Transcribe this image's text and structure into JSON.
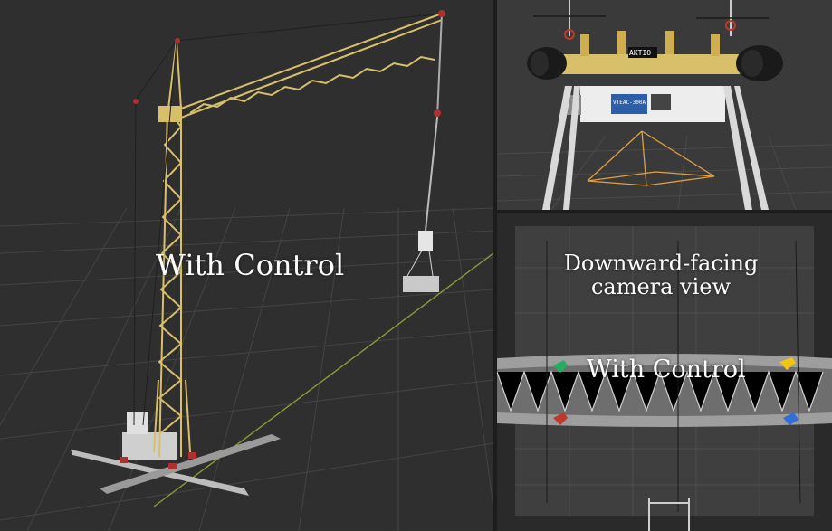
{
  "left_panel": {
    "overlay_label": "With Control",
    "scene": "crane-3d-view"
  },
  "top_right_panel": {
    "scene": "spreader-bar-with-camera",
    "brand_tag": "AKTIO",
    "device_label": "VTEAC-300A"
  },
  "bottom_right_panel": {
    "title": "Downward-facing camera view",
    "overlay_label": "With Control"
  },
  "colors": {
    "viewport_bg": "#2f2f2f",
    "grid_line": "#4a4a4a",
    "crane_yellow": "#d8c06a",
    "axis_green": "#8a9a3a",
    "frustum_orange": "#e0a040",
    "marker_red": "#c0392b",
    "marker_green": "#27ae60",
    "marker_yellow": "#f1c40f",
    "marker_blue": "#2e6fd9"
  }
}
